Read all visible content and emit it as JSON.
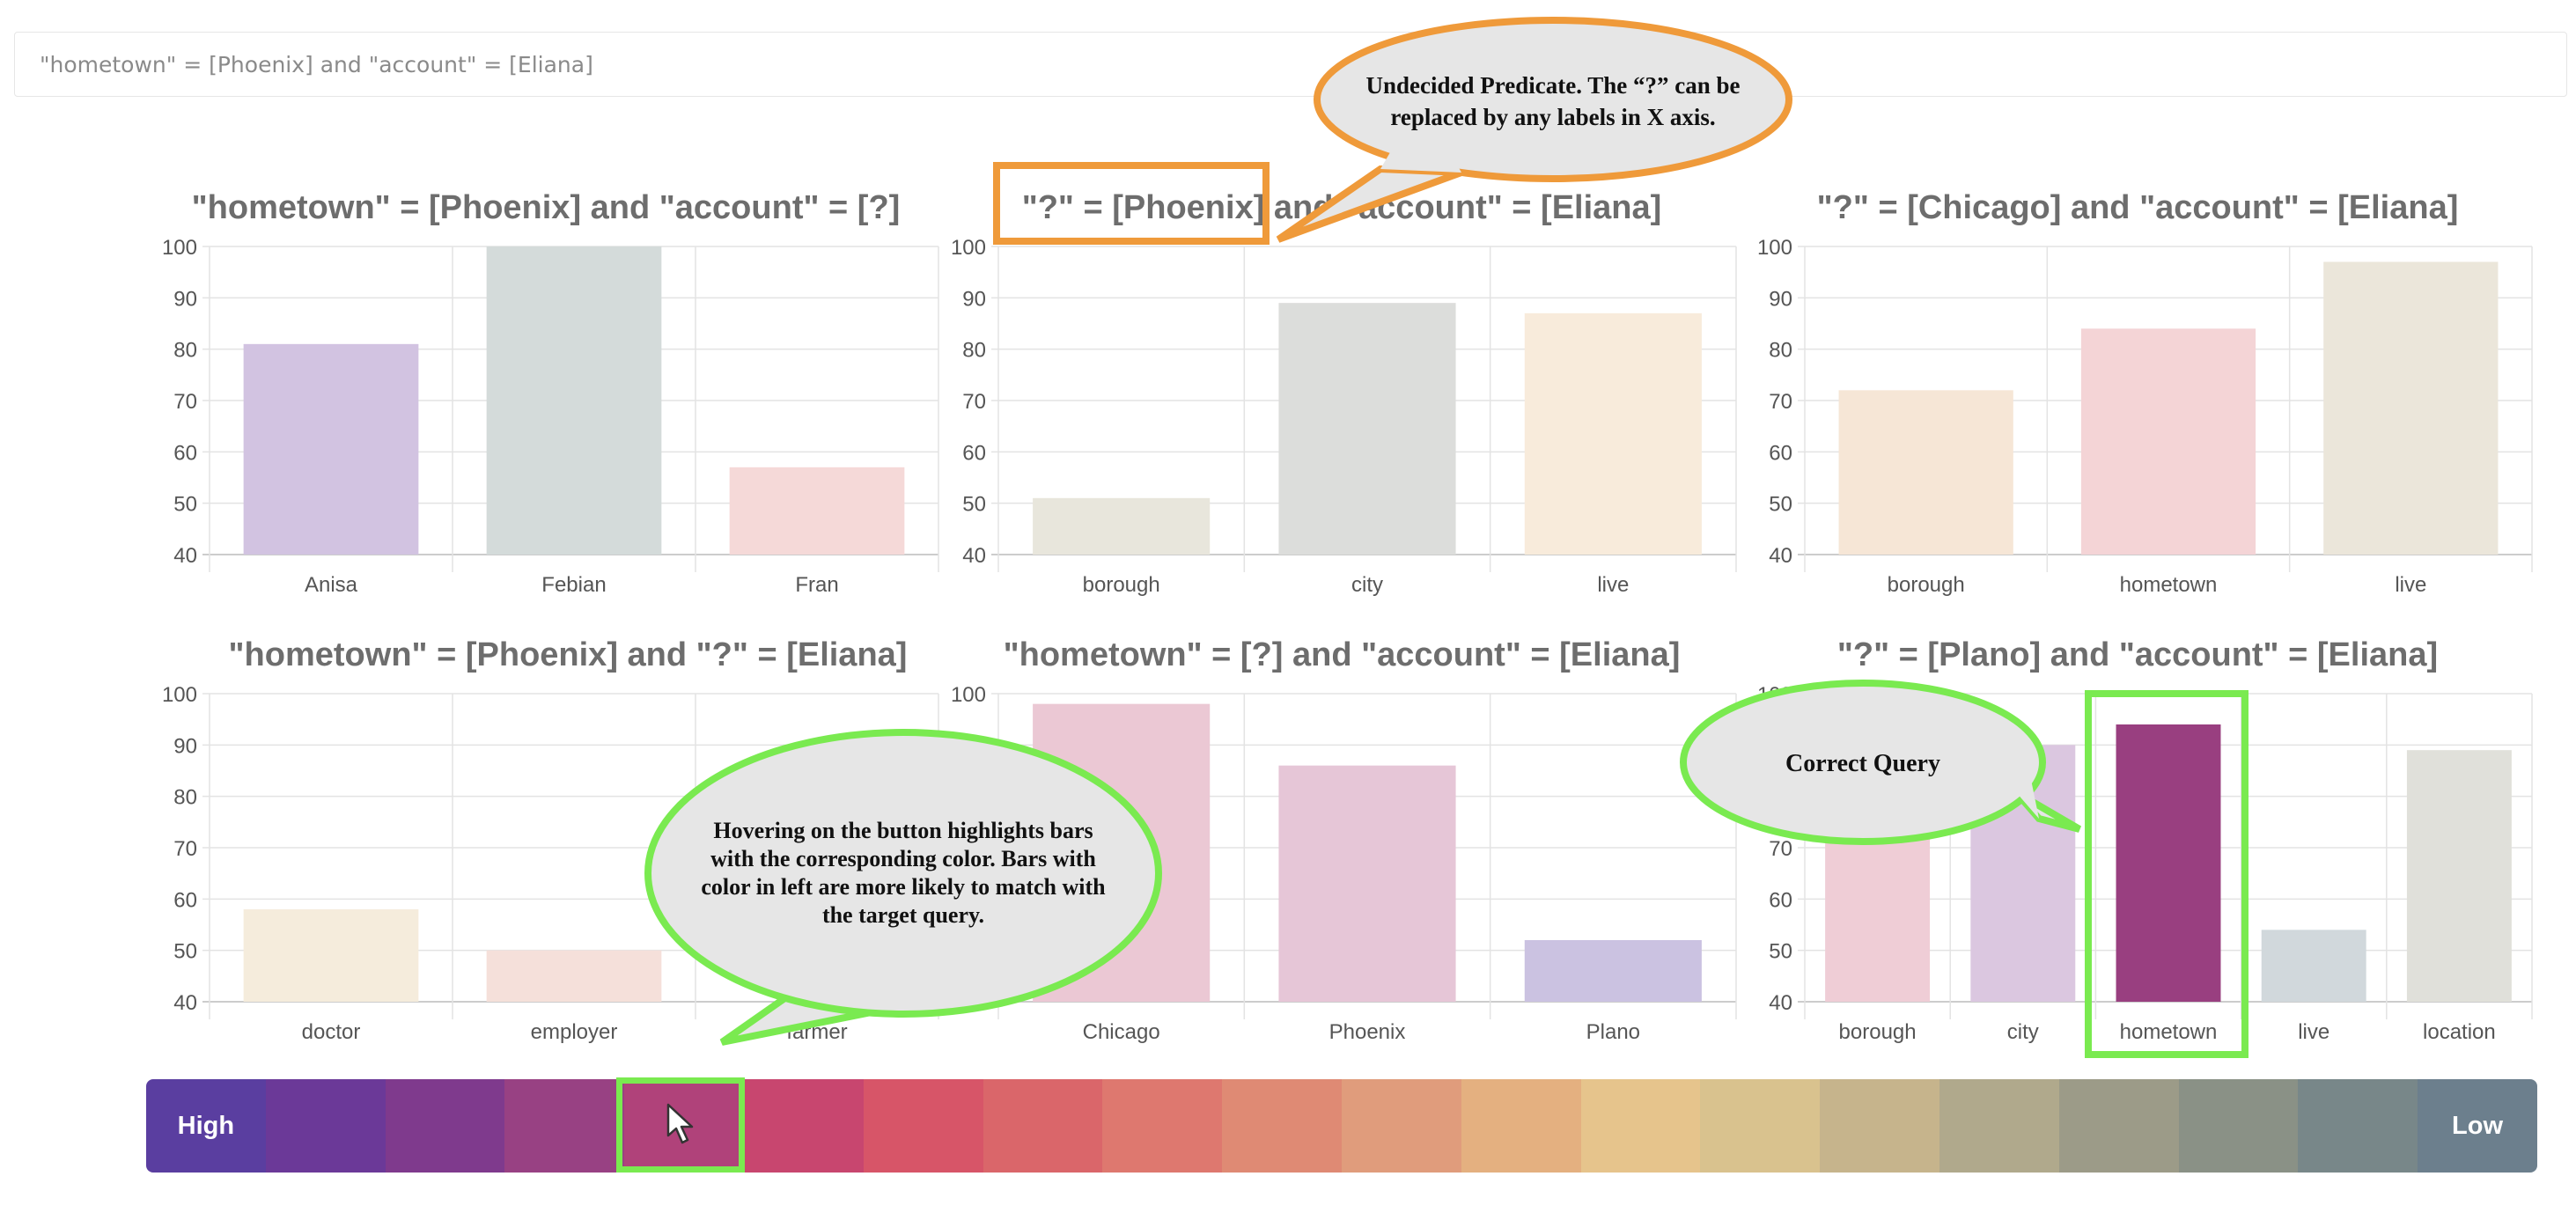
{
  "query": "\"hometown\" = [Phoenix] and \"account\" = [Eliana]",
  "colors": {
    "highlight_green": "#7aea50",
    "highlight_orange": "#ef9a3a",
    "callout_fill": "#e6e6e6",
    "axis_text": "#555555",
    "title_text": "#6d6d6d"
  },
  "chart_data": [
    {
      "type": "bar",
      "title": "\"hometown\" = [Phoenix] and \"account\" = [?]",
      "categories": [
        "Anisa",
        "Febian",
        "Fran"
      ],
      "values": [
        81,
        100,
        57
      ],
      "colors": [
        "#d2c3e1",
        "#d4dbda",
        "#f5d9d8"
      ],
      "ylim": [
        40,
        100
      ],
      "yticks": [
        100,
        90,
        80,
        70,
        60,
        50,
        40
      ],
      "grid": true
    },
    {
      "type": "bar",
      "title": "\"?\" = [Phoenix] and \"account\" = [Eliana]",
      "categories": [
        "borough",
        "city",
        "live"
      ],
      "values": [
        51,
        89,
        87
      ],
      "colors": [
        "#e8e6dc",
        "#dcdddb",
        "#f8ebdb"
      ],
      "ylim": [
        40,
        100
      ],
      "yticks": [
        100,
        90,
        80,
        70,
        60,
        50,
        40
      ],
      "grid": true
    },
    {
      "type": "bar",
      "title": "\"?\" = [Chicago] and \"account\" = [Eliana]",
      "categories": [
        "borough",
        "hometown",
        "live"
      ],
      "values": [
        72,
        84,
        97
      ],
      "colors": [
        "#f6e6d6",
        "#f4d4d6",
        "#ebe6da"
      ],
      "ylim": [
        40,
        100
      ],
      "yticks": [
        100,
        90,
        80,
        70,
        60,
        50,
        40
      ],
      "grid": true
    },
    {
      "type": "bar",
      "title": "\"hometown\" = [Phoenix] and \"?\" = [Eliana]",
      "categories": [
        "doctor",
        "employer",
        "farmer"
      ],
      "values": [
        58,
        50,
        40
      ],
      "colors": [
        "#f5ecdc",
        "#f5e0da",
        "#eeeeee"
      ],
      "ylim": [
        40,
        100
      ],
      "yticks": [
        100,
        90,
        80,
        70,
        60,
        50,
        40
      ],
      "grid": true
    },
    {
      "type": "bar",
      "title": "\"hometown\" = [?] and \"account\" = [Eliana]",
      "categories": [
        "Chicago",
        "Phoenix",
        "Plano"
      ],
      "values": [
        98,
        86,
        52
      ],
      "colors": [
        "#ebc8d4",
        "#e6c6d7",
        "#cbc2e1"
      ],
      "ylim": [
        40,
        100
      ],
      "yticks": [
        100,
        90,
        80,
        70,
        60,
        50,
        40
      ],
      "grid": true
    },
    {
      "type": "bar",
      "title": "\"?\" = [Plano] and \"account\" = [Eliana]",
      "categories": [
        "borough",
        "city",
        "hometown",
        "live",
        "location"
      ],
      "values": [
        72,
        90,
        94,
        54,
        89
      ],
      "colors": [
        "#efcdd6",
        "#dbc7e0",
        "#993f80",
        "#d1d8dc",
        "#e0e0da"
      ],
      "ylim": [
        40,
        100
      ],
      "yticks": [
        100,
        90,
        80,
        70,
        60,
        50,
        40
      ],
      "grid": true
    }
  ],
  "callouts": {
    "undecided": [
      "Undecided Predicate. The “?” can be",
      "replaced by any labels in X axis."
    ],
    "hover": [
      "Hovering on the button highlights bars",
      "with the corresponding color. Bars with",
      "color in left are more likely to match with",
      "the target query."
    ],
    "correct": [
      "Correct Query"
    ]
  },
  "legend": {
    "high_label": "High",
    "low_label": "Low",
    "colors": [
      "#5a3ea0",
      "#6b3998",
      "#7f3a8d",
      "#984183",
      "#b0427a",
      "#c8466f",
      "#d75568",
      "#da666a",
      "#de786f",
      "#df8a74",
      "#e09c7c",
      "#e4b080",
      "#e6c48c",
      "#d9c28e",
      "#c6b48c",
      "#b0a98c",
      "#9c9b88",
      "#8a9186",
      "#788789",
      "#6c7f8d"
    ]
  }
}
